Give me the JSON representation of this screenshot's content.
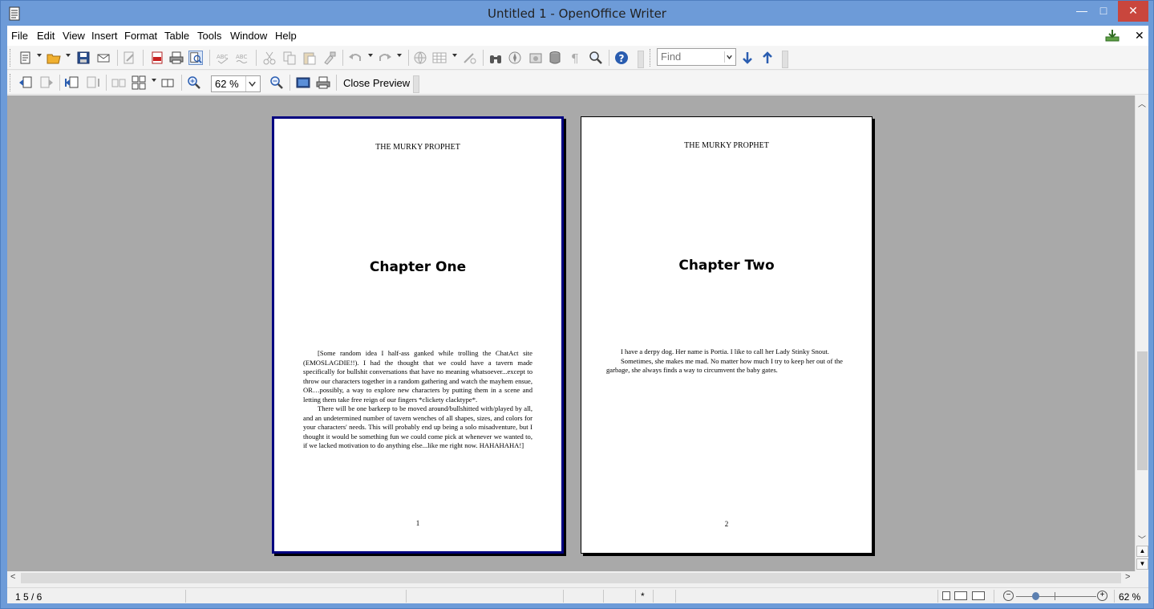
{
  "window": {
    "title": "Untitled 1 - OpenOffice Writer",
    "minimize": "—",
    "maximize": "□",
    "close": "✕"
  },
  "menubar": {
    "items": [
      "File",
      "Edit",
      "View",
      "Insert",
      "Format",
      "Table",
      "Tools",
      "Window",
      "Help"
    ],
    "close_doc": "✕"
  },
  "toolbar": {
    "find_placeholder": "Find",
    "zoom_value": "62 %",
    "close_preview_label": "Close Preview"
  },
  "pages": [
    {
      "header": "THE MURKY PROPHET",
      "chapter_title": "Chapter One",
      "paragraphs": [
        "[Some random idea I half-ass ganked while trolling the ChatAct site (EMOSLAGDIE!!). I had the thought that we could have a tavern made specifically for bullshit conversations that have no meaning whatsoever...except to throw our characters together in a random gathering and watch the mayhem ensue, OR…possibly, a way to explore new characters by putting them in a scene and letting them take free reign of our fingers *clickety clacktype*.",
        "There will be one barkeep to be moved around/bullshitted with/played by all, and an undetermined number of tavern wenches of all shapes, sizes, and colors for your characters' needs. This will probably end up being a solo misadventure, but I thought it would be something fun we could come pick at whenever we wanted to, if we lacked motivation to do anything else...like me right now. HAHAHAHA!]"
      ],
      "page_number": "1"
    },
    {
      "header": "THE MURKY PROPHET",
      "chapter_title": "Chapter Two",
      "paragraphs": [
        "I have a derpy dog. Her name is Portia. I like to call her Lady Stinky Snout.",
        "Sometimes, she makes me mad. No matter how much I try to keep her out of the garbage, she always finds a way to circumvent the baby gates."
      ],
      "page_number": "2"
    }
  ],
  "statusbar": {
    "page_status": "1 5 / 6",
    "modified_indicator": "*",
    "zoom_percent": "62 %"
  },
  "colors": {
    "title_bar": "#6d9bd8",
    "preview_background": "#a9a9a9",
    "selected_page_border": "#000080",
    "close_button": "#c9463d"
  }
}
